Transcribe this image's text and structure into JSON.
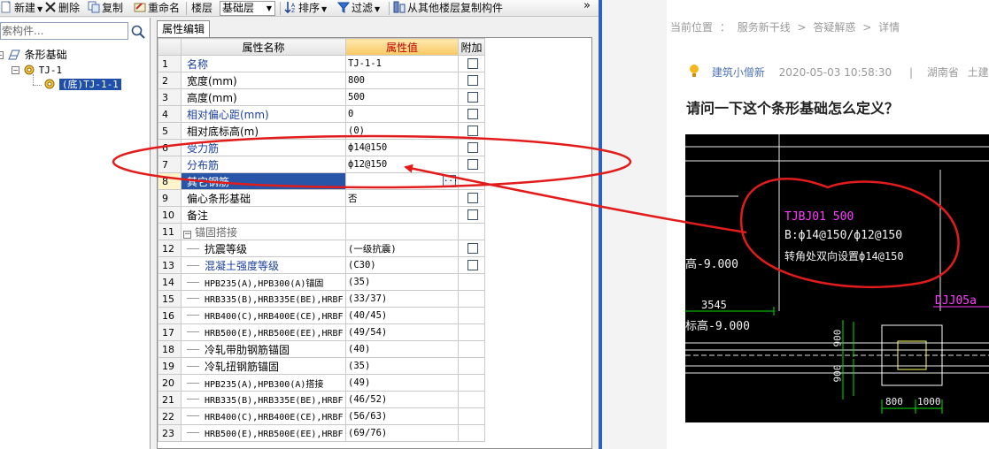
{
  "toolbar": {
    "new_label": "新建",
    "delete_label": "删除",
    "copy_label": "复制",
    "rename_label": "重命名",
    "floor_label": "楼层",
    "floor_value": "基础层",
    "sort_label": "排序",
    "filter_label": "过滤",
    "copy_from_floor_label": "从其他楼层复制构件",
    "overflow_label": "»"
  },
  "tree": {
    "search_placeholder": "索构件...",
    "root_label": "条形基础",
    "child_label": "TJ-1",
    "leaf_label": "(底)TJ-1-1"
  },
  "props": {
    "tab_label": "属性编辑",
    "col_name": "属性名称",
    "col_value": "属性值",
    "col_extra": "附加",
    "rows": [
      {
        "n": "1",
        "name": "名称",
        "value": "TJ-1-1"
      },
      {
        "n": "2",
        "name": "宽度(mm)",
        "value": "800"
      },
      {
        "n": "3",
        "name": "高度(mm)",
        "value": "500"
      },
      {
        "n": "4",
        "name": "相对偏心距(mm)",
        "value": "0"
      },
      {
        "n": "5",
        "name": "相对底标高(m)",
        "value": "(0)"
      },
      {
        "n": "6",
        "name": "受力筋",
        "value": "ф14@150"
      },
      {
        "n": "7",
        "name": "分布筋",
        "value": "ф12@150"
      },
      {
        "n": "8",
        "name": "其它钢筋",
        "value": ""
      },
      {
        "n": "9",
        "name": "偏心条形基础",
        "value": "否"
      },
      {
        "n": "10",
        "name": "备注",
        "value": ""
      },
      {
        "n": "11",
        "name": "锚固搭接",
        "value": ""
      },
      {
        "n": "12",
        "name": "抗震等级",
        "value": "(一级抗震)"
      },
      {
        "n": "13",
        "name": "混凝土强度等级",
        "value": "(C30)"
      },
      {
        "n": "14",
        "name": "HPB235(A),HPB300(A)锚固",
        "value": "(35)"
      },
      {
        "n": "15",
        "name": "HRB335(B),HRB335E(BE),HRBF",
        "value": "(33/37)"
      },
      {
        "n": "16",
        "name": "HRB400(C),HRB400E(CE),HRBF",
        "value": "(40/45)"
      },
      {
        "n": "17",
        "name": "HRB500(E),HRB500E(EE),HRBF",
        "value": "(49/54)"
      },
      {
        "n": "18",
        "name": "冷轧带肋钢筋锚固",
        "value": "(40)"
      },
      {
        "n": "19",
        "name": "冷轧扭钢筋锚固",
        "value": "(35)"
      },
      {
        "n": "20",
        "name": "HPB235(A),HPB300(A)搭接",
        "value": "(49)"
      },
      {
        "n": "21",
        "name": "HRB335(B),HRB335E(BE),HRBF",
        "value": "(46/52)"
      },
      {
        "n": "22",
        "name": "HRB400(C),HRB400E(CE),HRBF",
        "value": "(56/63)"
      },
      {
        "n": "23",
        "name": "HRB500(E),HRB500E(EE),HRBF",
        "value": "(69/76)"
      }
    ],
    "ellipsis": "..."
  },
  "web": {
    "breadcrumb": [
      "当前位置",
      "：",
      "服务新干线",
      ">",
      "答疑解惑",
      ">",
      "详情"
    ],
    "author": "建筑小僧新",
    "datetime": "2020-05-03 10:58:30",
    "meta_sep": "|",
    "region": "湖南省",
    "category": "土建算量",
    "title": "请问一下这个条形基础怎么定义？"
  },
  "cad": {
    "label_tjbj": "TJBJ01 500",
    "label_bars": "B:ф14@150/ф12@150",
    "label_corner": "转角处双向设置ф14@150",
    "label_elev1": "高-9.000",
    "label_3545": "3545",
    "label_elev2": "标高-9.000",
    "label_djj": "DJJ05a",
    "dim_900a": "900",
    "dim_900b": "900",
    "dim_800": "800",
    "dim_1000": "1000"
  },
  "colors": {
    "annotation_red": "#e21b1b",
    "cad_magenta": "#ff3cff",
    "cad_green": "#00e000",
    "selection_blue": "#2855a8"
  }
}
